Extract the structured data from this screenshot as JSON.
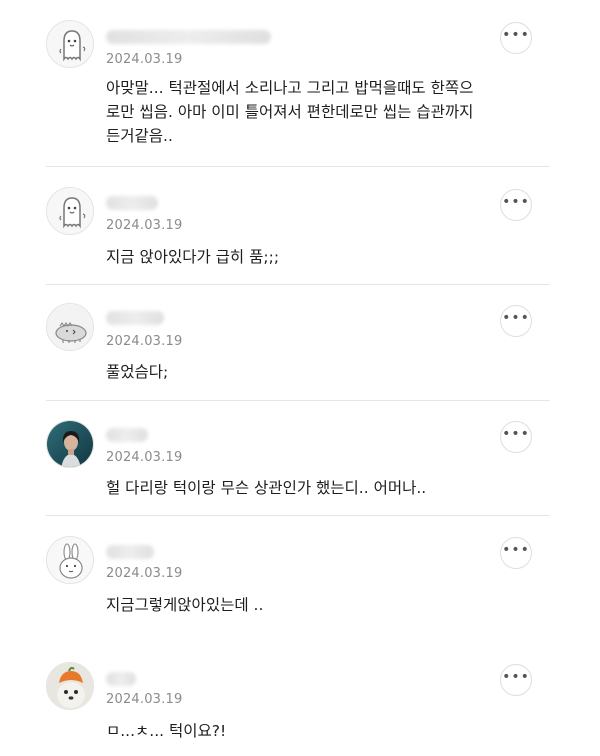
{
  "comments": [
    {
      "avatar_icon": "ghost-character-icon",
      "date": "2024.03.19",
      "body": "아맞말... 턱관절에서 소리나고 그리고 밥먹을때도 한쪽으\n로만 씹음. 아마 이미 틀어져서 편한데로만 씹는 습관까지\n든거같음..",
      "more_label": "•••"
    },
    {
      "avatar_icon": "ghost-character-icon",
      "date": "2024.03.19",
      "body": "지금 앉아있다가 급히 품;;;",
      "more_label": "•••"
    },
    {
      "avatar_icon": "dinosaur-character-icon",
      "date": "2024.03.19",
      "body": "풀었슴다;",
      "more_label": "•••"
    },
    {
      "avatar_icon": "profile-photo-icon",
      "date": "2024.03.19",
      "body": "헐 다리랑 턱이랑 무슨 상관인가 했는디.. 어머나..",
      "more_label": "•••"
    },
    {
      "avatar_icon": "rabbit-character-icon",
      "date": "2024.03.19",
      "body": "지금그렇게앉아있는데 ..",
      "more_label": "•••"
    },
    {
      "avatar_icon": "dog-with-hat-photo-icon",
      "date": "2024.03.19",
      "body": "ㅁ...ㅊ... 턱이요?!",
      "more_label": "•••"
    }
  ]
}
